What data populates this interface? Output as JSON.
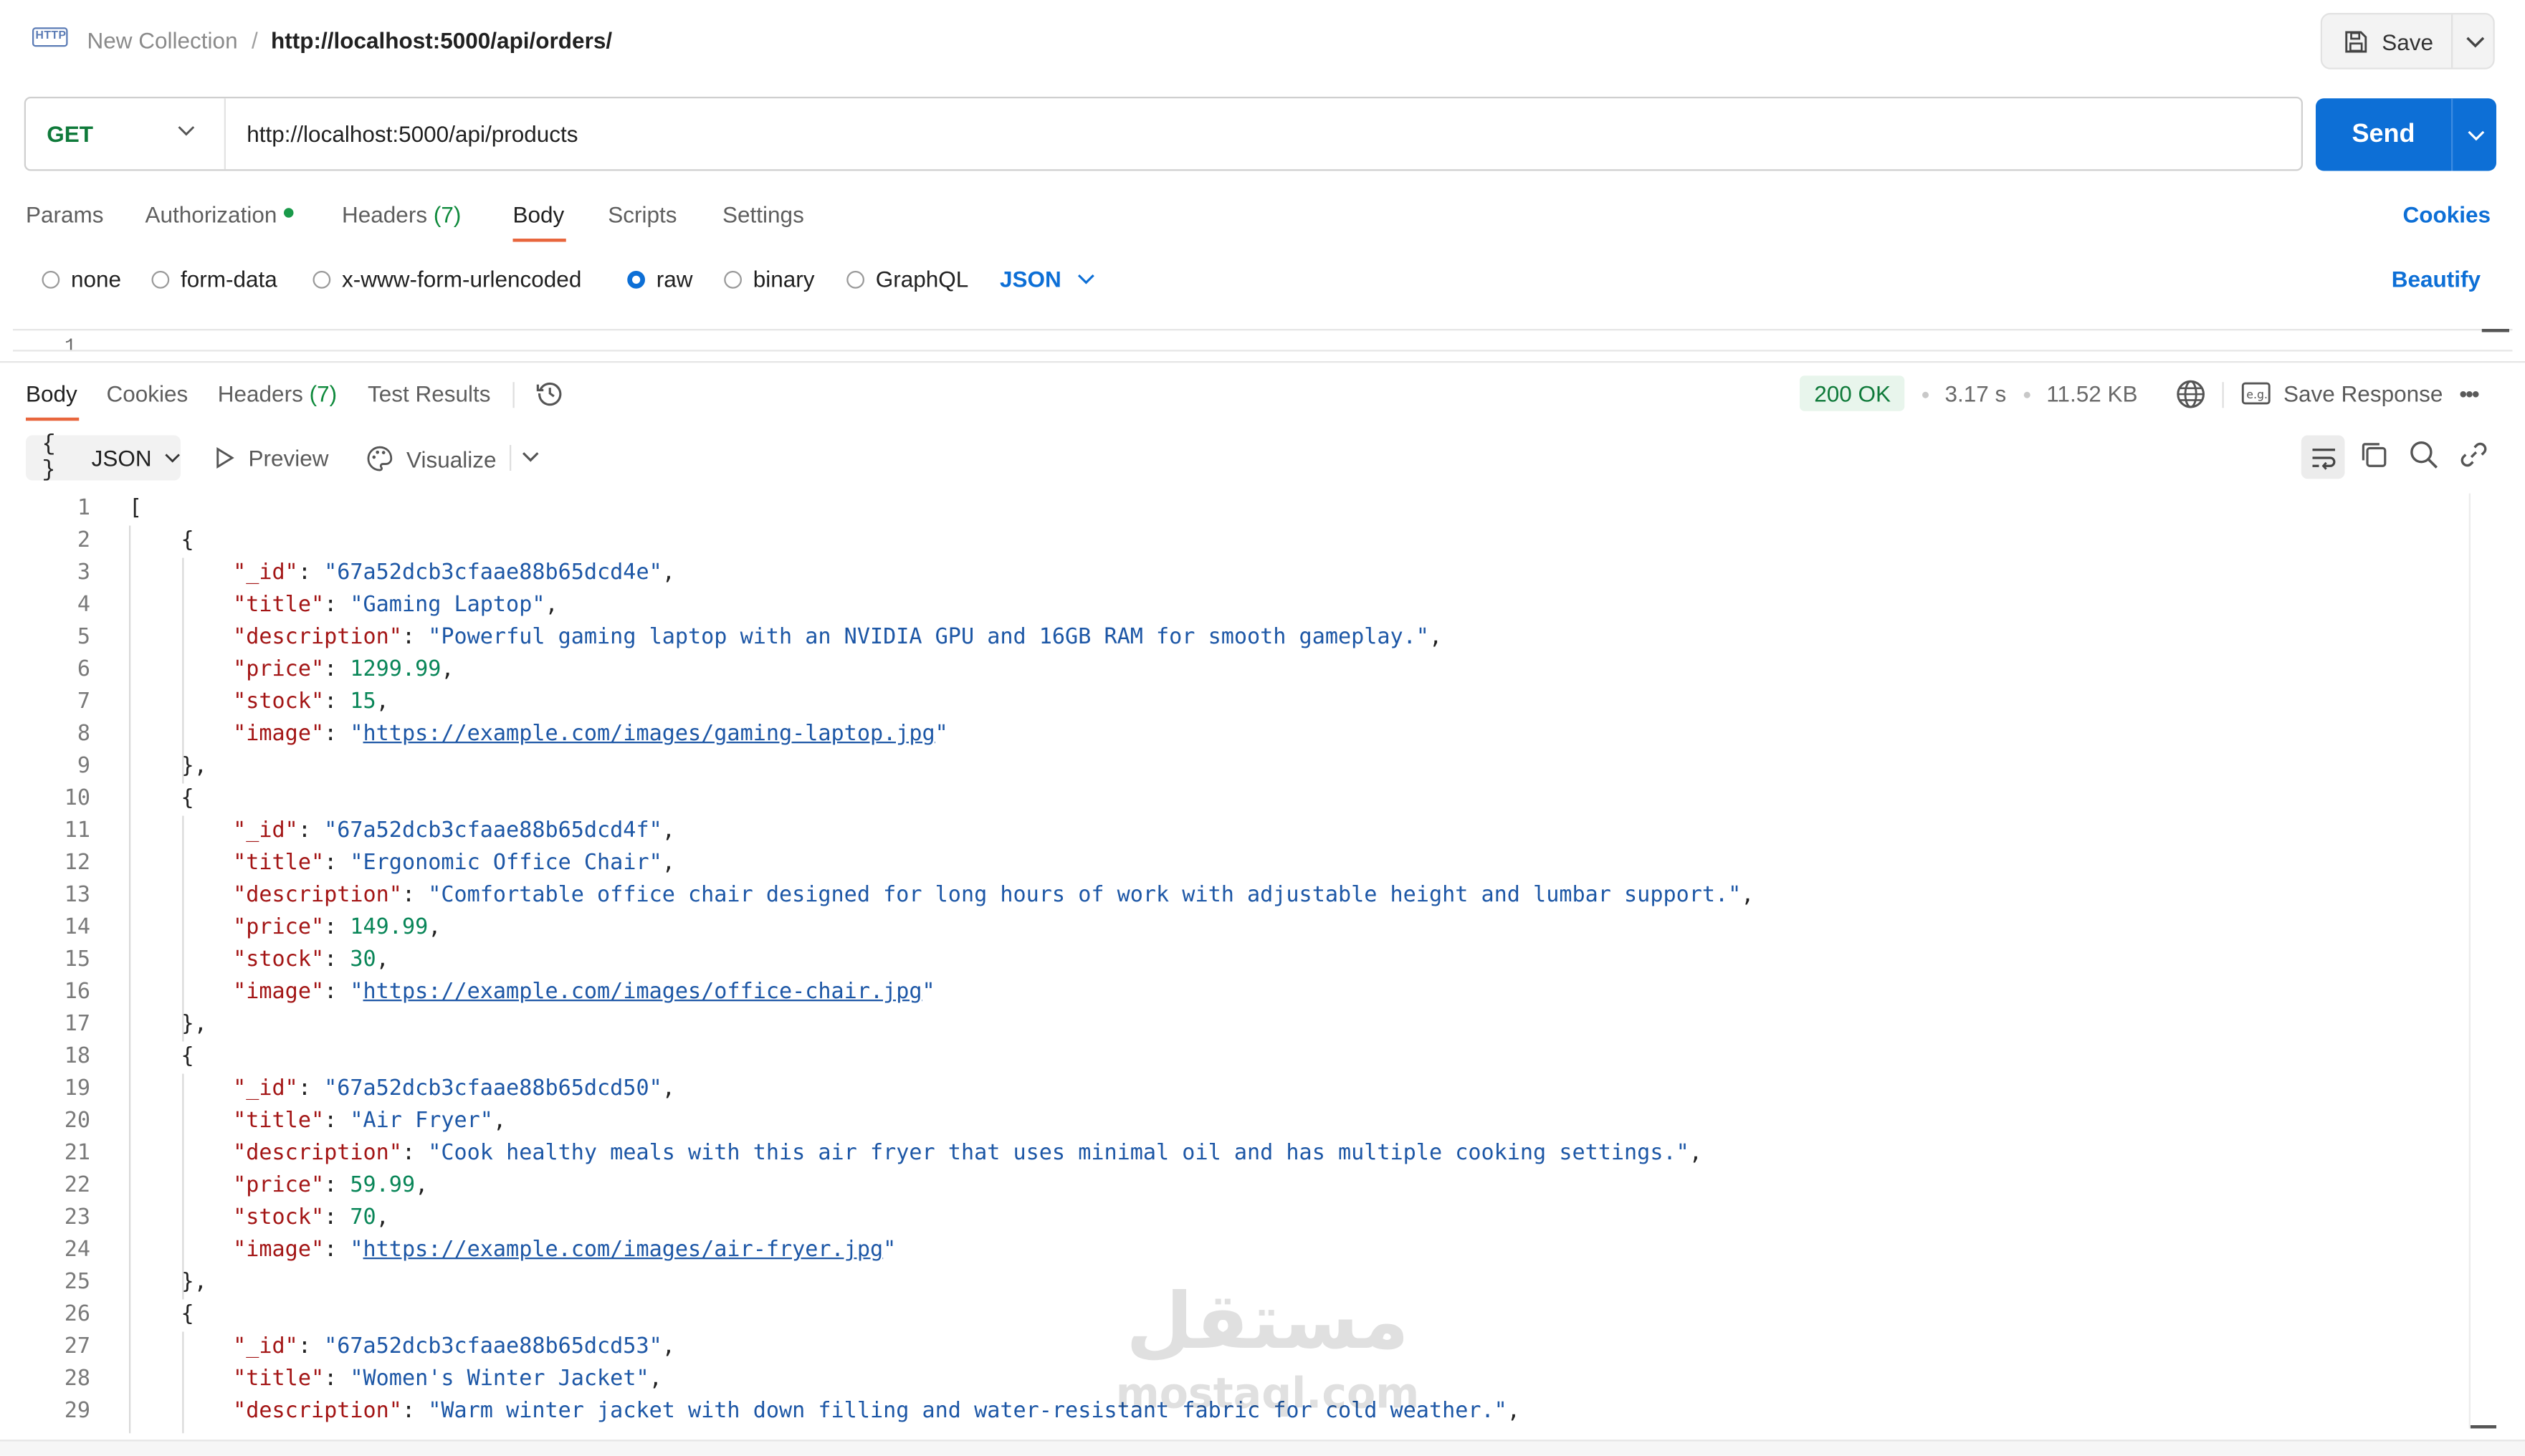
{
  "breadcrumb": {
    "icon_label": "HTTP",
    "collection": "New Collection",
    "separator": "/",
    "request": "http://localhost:5000/api/orders/"
  },
  "toolbar": {
    "save_label": "Save"
  },
  "request": {
    "method": "GET",
    "url": "http://localhost:5000/api/products",
    "send_label": "Send"
  },
  "request_tabs": {
    "params": "Params",
    "authorization": "Authorization",
    "headers": "Headers",
    "headers_count": "(7)",
    "body": "Body",
    "scripts": "Scripts",
    "settings": "Settings",
    "cookies": "Cookies"
  },
  "body_types": {
    "none": "none",
    "form_data": "form-data",
    "urlencoded": "x-www-form-urlencoded",
    "raw": "raw",
    "binary": "binary",
    "graphql": "GraphQL",
    "selected": "raw",
    "format": "JSON",
    "beautify": "Beautify"
  },
  "request_editor": {
    "line1": "1"
  },
  "response_tabs": {
    "body": "Body",
    "cookies": "Cookies",
    "headers": "Headers",
    "headers_count": "(7)",
    "test_results": "Test Results"
  },
  "response_meta": {
    "status": "200 OK",
    "time": "3.17 s",
    "size": "11.52 KB",
    "save_response": "Save Response",
    "status_color": "#0f7a3a"
  },
  "response_toolbar": {
    "format_braces": "{ }",
    "format": "JSON",
    "preview": "Preview",
    "visualize": "Visualize"
  },
  "code_lines": [
    {
      "n": "1",
      "parts": [
        [
          "p",
          "["
        ]
      ]
    },
    {
      "n": "2",
      "parts": [
        [
          "p",
          "    {"
        ]
      ]
    },
    {
      "n": "3",
      "parts": [
        [
          "p",
          "        "
        ],
        [
          "k",
          "\"_id\""
        ],
        [
          "p",
          ": "
        ],
        [
          "s",
          "\"67a52dcb3cfaae88b65dcd4e\""
        ],
        [
          "p",
          ","
        ]
      ]
    },
    {
      "n": "4",
      "parts": [
        [
          "p",
          "        "
        ],
        [
          "k",
          "\"title\""
        ],
        [
          "p",
          ": "
        ],
        [
          "s",
          "\"Gaming Laptop\""
        ],
        [
          "p",
          ","
        ]
      ]
    },
    {
      "n": "5",
      "parts": [
        [
          "p",
          "        "
        ],
        [
          "k",
          "\"description\""
        ],
        [
          "p",
          ": "
        ],
        [
          "s",
          "\"Powerful gaming laptop with an NVIDIA GPU and 16GB RAM for smooth gameplay.\""
        ],
        [
          "p",
          ","
        ]
      ]
    },
    {
      "n": "6",
      "parts": [
        [
          "p",
          "        "
        ],
        [
          "k",
          "\"price\""
        ],
        [
          "p",
          ": "
        ],
        [
          "n",
          "1299.99"
        ],
        [
          "p",
          ","
        ]
      ]
    },
    {
      "n": "7",
      "parts": [
        [
          "p",
          "        "
        ],
        [
          "k",
          "\"stock\""
        ],
        [
          "p",
          ": "
        ],
        [
          "n",
          "15"
        ],
        [
          "p",
          ","
        ]
      ]
    },
    {
      "n": "8",
      "parts": [
        [
          "p",
          "        "
        ],
        [
          "k",
          "\"image\""
        ],
        [
          "p",
          ": "
        ],
        [
          "s",
          "\""
        ],
        [
          "u",
          "https://example.com/images/gaming-laptop.jpg"
        ],
        [
          "s",
          "\""
        ]
      ]
    },
    {
      "n": "9",
      "parts": [
        [
          "p",
          "    },"
        ]
      ]
    },
    {
      "n": "10",
      "parts": [
        [
          "p",
          "    {"
        ]
      ]
    },
    {
      "n": "11",
      "parts": [
        [
          "p",
          "        "
        ],
        [
          "k",
          "\"_id\""
        ],
        [
          "p",
          ": "
        ],
        [
          "s",
          "\"67a52dcb3cfaae88b65dcd4f\""
        ],
        [
          "p",
          ","
        ]
      ]
    },
    {
      "n": "12",
      "parts": [
        [
          "p",
          "        "
        ],
        [
          "k",
          "\"title\""
        ],
        [
          "p",
          ": "
        ],
        [
          "s",
          "\"Ergonomic Office Chair\""
        ],
        [
          "p",
          ","
        ]
      ]
    },
    {
      "n": "13",
      "parts": [
        [
          "p",
          "        "
        ],
        [
          "k",
          "\"description\""
        ],
        [
          "p",
          ": "
        ],
        [
          "s",
          "\"Comfortable office chair designed for long hours of work with adjustable height and lumbar support.\""
        ],
        [
          "p",
          ","
        ]
      ]
    },
    {
      "n": "14",
      "parts": [
        [
          "p",
          "        "
        ],
        [
          "k",
          "\"price\""
        ],
        [
          "p",
          ": "
        ],
        [
          "n",
          "149.99"
        ],
        [
          "p",
          ","
        ]
      ]
    },
    {
      "n": "15",
      "parts": [
        [
          "p",
          "        "
        ],
        [
          "k",
          "\"stock\""
        ],
        [
          "p",
          ": "
        ],
        [
          "n",
          "30"
        ],
        [
          "p",
          ","
        ]
      ]
    },
    {
      "n": "16",
      "parts": [
        [
          "p",
          "        "
        ],
        [
          "k",
          "\"image\""
        ],
        [
          "p",
          ": "
        ],
        [
          "s",
          "\""
        ],
        [
          "u",
          "https://example.com/images/office-chair.jpg"
        ],
        [
          "s",
          "\""
        ]
      ]
    },
    {
      "n": "17",
      "parts": [
        [
          "p",
          "    },"
        ]
      ]
    },
    {
      "n": "18",
      "parts": [
        [
          "p",
          "    {"
        ]
      ]
    },
    {
      "n": "19",
      "parts": [
        [
          "p",
          "        "
        ],
        [
          "k",
          "\"_id\""
        ],
        [
          "p",
          ": "
        ],
        [
          "s",
          "\"67a52dcb3cfaae88b65dcd50\""
        ],
        [
          "p",
          ","
        ]
      ]
    },
    {
      "n": "20",
      "parts": [
        [
          "p",
          "        "
        ],
        [
          "k",
          "\"title\""
        ],
        [
          "p",
          ": "
        ],
        [
          "s",
          "\"Air Fryer\""
        ],
        [
          "p",
          ","
        ]
      ]
    },
    {
      "n": "21",
      "parts": [
        [
          "p",
          "        "
        ],
        [
          "k",
          "\"description\""
        ],
        [
          "p",
          ": "
        ],
        [
          "s",
          "\"Cook healthy meals with this air fryer that uses minimal oil and has multiple cooking settings.\""
        ],
        [
          "p",
          ","
        ]
      ]
    },
    {
      "n": "22",
      "parts": [
        [
          "p",
          "        "
        ],
        [
          "k",
          "\"price\""
        ],
        [
          "p",
          ": "
        ],
        [
          "n",
          "59.99"
        ],
        [
          "p",
          ","
        ]
      ]
    },
    {
      "n": "23",
      "parts": [
        [
          "p",
          "        "
        ],
        [
          "k",
          "\"stock\""
        ],
        [
          "p",
          ": "
        ],
        [
          "n",
          "70"
        ],
        [
          "p",
          ","
        ]
      ]
    },
    {
      "n": "24",
      "parts": [
        [
          "p",
          "        "
        ],
        [
          "k",
          "\"image\""
        ],
        [
          "p",
          ": "
        ],
        [
          "s",
          "\""
        ],
        [
          "u",
          "https://example.com/images/air-fryer.jpg"
        ],
        [
          "s",
          "\""
        ]
      ]
    },
    {
      "n": "25",
      "parts": [
        [
          "p",
          "    },"
        ]
      ]
    },
    {
      "n": "26",
      "parts": [
        [
          "p",
          "    {"
        ]
      ]
    },
    {
      "n": "27",
      "parts": [
        [
          "p",
          "        "
        ],
        [
          "k",
          "\"_id\""
        ],
        [
          "p",
          ": "
        ],
        [
          "s",
          "\"67a52dcb3cfaae88b65dcd53\""
        ],
        [
          "p",
          ","
        ]
      ]
    },
    {
      "n": "28",
      "parts": [
        [
          "p",
          "        "
        ],
        [
          "k",
          "\"title\""
        ],
        [
          "p",
          ": "
        ],
        [
          "s",
          "\"Women's Winter Jacket\""
        ],
        [
          "p",
          ","
        ]
      ]
    },
    {
      "n": "29",
      "parts": [
        [
          "p",
          "        "
        ],
        [
          "k",
          "\"description\""
        ],
        [
          "p",
          ": "
        ],
        [
          "s",
          "\"Warm winter jacket with down filling and water-resistant fabric for cold weather.\""
        ],
        [
          "p",
          ","
        ]
      ]
    }
  ],
  "watermark": {
    "arabic": "مستقل",
    "latin": "mostaql.com"
  },
  "colors": {
    "accent": "#0d6fd6",
    "tab_underline": "#e8663d",
    "key": "#a31515",
    "string": "#1d57a6",
    "number": "#098658"
  }
}
